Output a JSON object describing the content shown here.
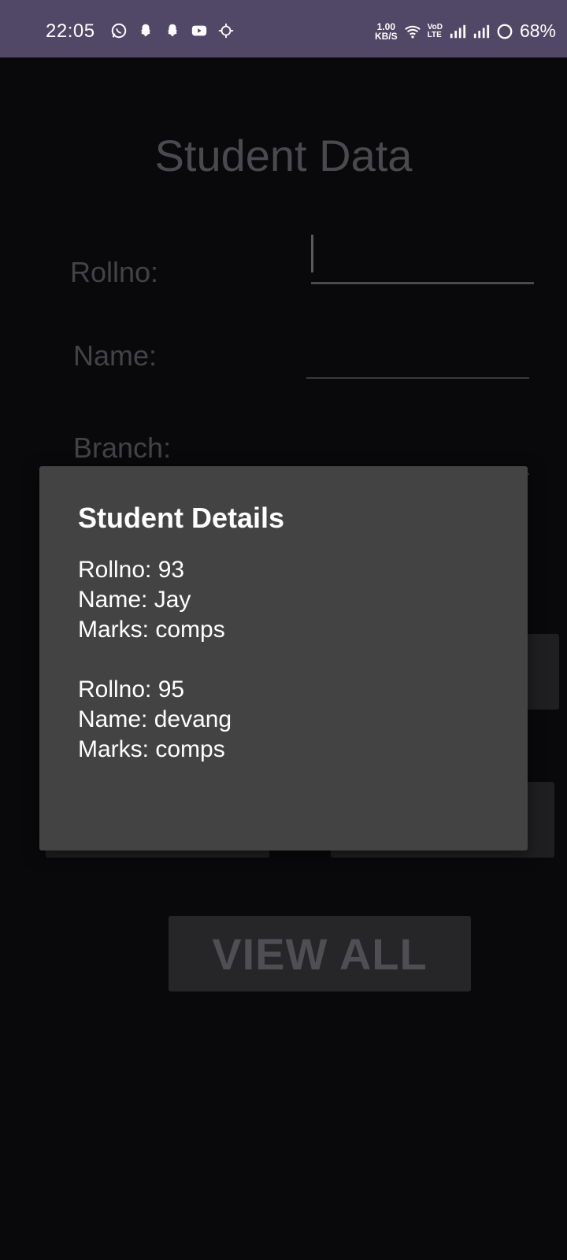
{
  "status_bar": {
    "time": "22:05",
    "left_icons": [
      "whatsapp-icon",
      "snapchat-icon",
      "snapchat-icon",
      "youtube-icon",
      "sync-icon"
    ],
    "speed_value": "1.00",
    "speed_unit": "KB/S",
    "volte_top": "VoD",
    "volte_bottom": "LTE",
    "battery": "68%"
  },
  "app": {
    "title": "Student Data",
    "fields": {
      "rollno_label": "Rollno:",
      "name_label": "Name:",
      "branch_label": "Branch:"
    },
    "view_all_label": "VIEW ALL"
  },
  "dialog": {
    "title": "Student Details",
    "records": [
      {
        "rollno": "Rollno: 93",
        "name": "Name: Jay",
        "marks": "Marks: comps"
      },
      {
        "rollno": "Rollno: 95",
        "name": "Name: devang",
        "marks": "Marks: comps"
      }
    ]
  }
}
